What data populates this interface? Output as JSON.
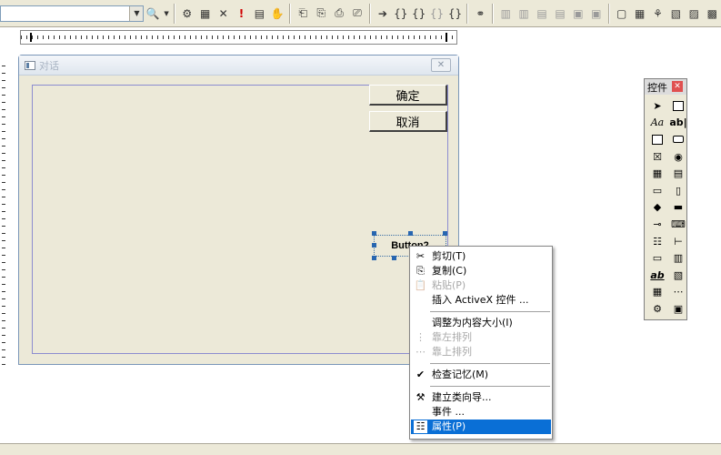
{
  "dialog": {
    "title": "对话",
    "ok_label": "确定",
    "cancel_label": "取消",
    "button2_label": "Button2"
  },
  "toolbox": {
    "title": "控件",
    "close_glyph": "✕"
  },
  "context_menu": {
    "items": [
      {
        "label": "剪切(T)",
        "icon": "✂",
        "disabled": false
      },
      {
        "label": "复制(C)",
        "icon": "⎘",
        "disabled": false
      },
      {
        "label": "粘贴(P)",
        "icon": "📋",
        "disabled": true
      },
      {
        "label": "插入 ActiveX 控件 ...",
        "icon": "",
        "disabled": false
      },
      {
        "label": "调整为内容大小(I)",
        "icon": "",
        "disabled": false
      },
      {
        "label": "靠左排列",
        "icon": "⋮",
        "disabled": true
      },
      {
        "label": "靠上排列",
        "icon": "⋯",
        "disabled": true
      },
      {
        "label": "检查记忆(M)",
        "icon": "✔",
        "disabled": false
      },
      {
        "label": "建立类向导...",
        "icon": "⚒",
        "disabled": false
      },
      {
        "label": "事件 ...",
        "icon": "",
        "disabled": false
      },
      {
        "label": "属性(P)",
        "icon": "☷",
        "disabled": false,
        "selected": true
      }
    ]
  },
  "colors": {
    "menu_highlight": "#0a6fd6",
    "selection_handle": "#2866b0"
  }
}
